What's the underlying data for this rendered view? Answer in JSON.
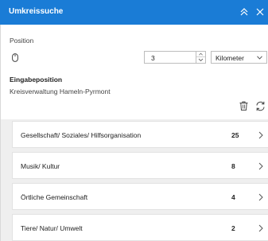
{
  "header": {
    "title": "Umkreissuche",
    "collapse_icon": "double-chevron-up-icon",
    "close_icon": "close-icon"
  },
  "position": {
    "label": "Position",
    "location_icon": "mouse-pointer-icon",
    "distance_value": "3",
    "unit_selected": "Kilometer"
  },
  "input_position": {
    "heading": "Eingabeposition",
    "address": "Kreisverwaltung Hameln-Pyrmont"
  },
  "actions": {
    "delete_icon": "trash-icon",
    "refresh_icon": "refresh-icon"
  },
  "categories": [
    {
      "label": "Gesellschaft/ Soziales/ Hilfsorganisation",
      "count": "25"
    },
    {
      "label": "Musik/ Kultur",
      "count": "8"
    },
    {
      "label": "Örtliche Gemeinschaft",
      "count": "4"
    },
    {
      "label": "Tiere/ Natur/ Umwelt",
      "count": "2"
    }
  ],
  "colors": {
    "accent": "#1a7cd6",
    "list_background": "#efefef",
    "text": "#222222"
  }
}
